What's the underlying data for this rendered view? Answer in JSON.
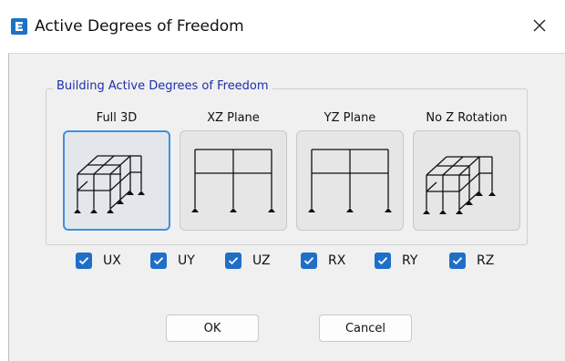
{
  "window": {
    "title": "Active Degrees of Freedom",
    "app_icon_letter": "E",
    "accent": "#1a73c7"
  },
  "group": {
    "legend": "Building Active Degrees of Freedom"
  },
  "options": [
    {
      "label": "Full 3D",
      "icon": "3d-frame-icon",
      "selected": true
    },
    {
      "label": "XZ Plane",
      "icon": "xz-plane-frame-icon",
      "selected": false
    },
    {
      "label": "YZ Plane",
      "icon": "yz-plane-frame-icon",
      "selected": false
    },
    {
      "label": "No Z Rotation",
      "icon": "no-z-rotation-frame-icon",
      "selected": false
    }
  ],
  "checkboxes": [
    {
      "label": "UX",
      "checked": true
    },
    {
      "label": "UY",
      "checked": true
    },
    {
      "label": "UZ",
      "checked": true
    },
    {
      "label": "RX",
      "checked": true
    },
    {
      "label": "RY",
      "checked": true
    },
    {
      "label": "RZ",
      "checked": true
    }
  ],
  "buttons": {
    "ok": "OK",
    "cancel": "Cancel"
  }
}
